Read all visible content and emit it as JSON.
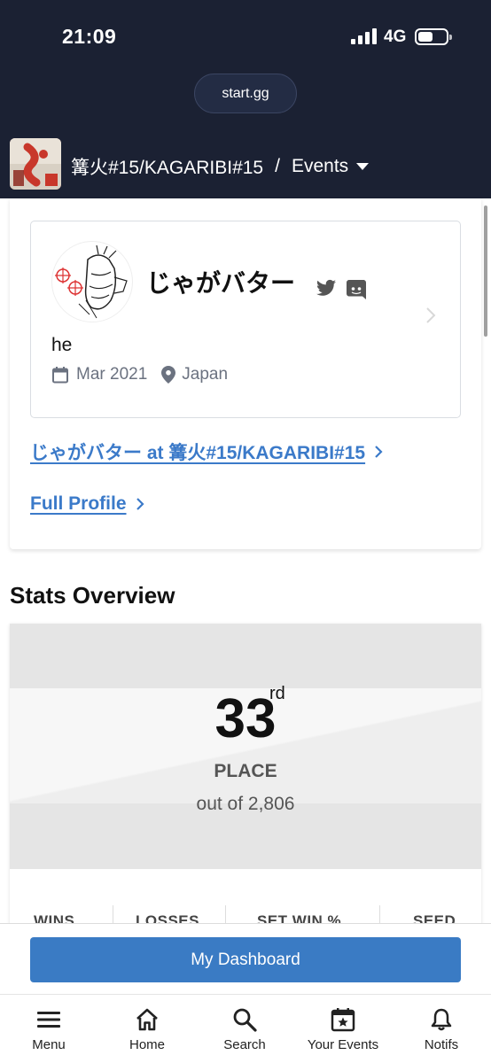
{
  "status_bar": {
    "time": "21:09",
    "network": "4G"
  },
  "browser": {
    "url": "start.gg"
  },
  "header": {
    "tournament": "篝火#15/KAGARIBI#15",
    "separator": "/",
    "section": "Events"
  },
  "player": {
    "name": "じゃがバター",
    "bio": "he",
    "joined": "Mar 2021",
    "location": "Japan",
    "event_link": "じゃがバター at 篝火#15/KAGARIBI#15",
    "full_profile_link": "Full Profile"
  },
  "stats": {
    "title": "Stats Overview",
    "placement": "33",
    "suffix": "rd",
    "place_label": "PLACE",
    "out_of": "out of 2,806",
    "columns": [
      "WINS",
      "LOSSES",
      "SET WIN %",
      "SEED"
    ]
  },
  "dashboard": {
    "button_label": "My Dashboard"
  },
  "nav": {
    "items": [
      {
        "label": "Menu",
        "icon": "hamburger-icon"
      },
      {
        "label": "Home",
        "icon": "home-icon"
      },
      {
        "label": "Search",
        "icon": "search-icon"
      },
      {
        "label": "Your Events",
        "icon": "calendar-star-icon"
      },
      {
        "label": "Notifs",
        "icon": "bell-icon"
      }
    ]
  },
  "colors": {
    "header_bg": "#1b2133",
    "link": "#3b7ac9",
    "button": "#3a7bc4"
  }
}
